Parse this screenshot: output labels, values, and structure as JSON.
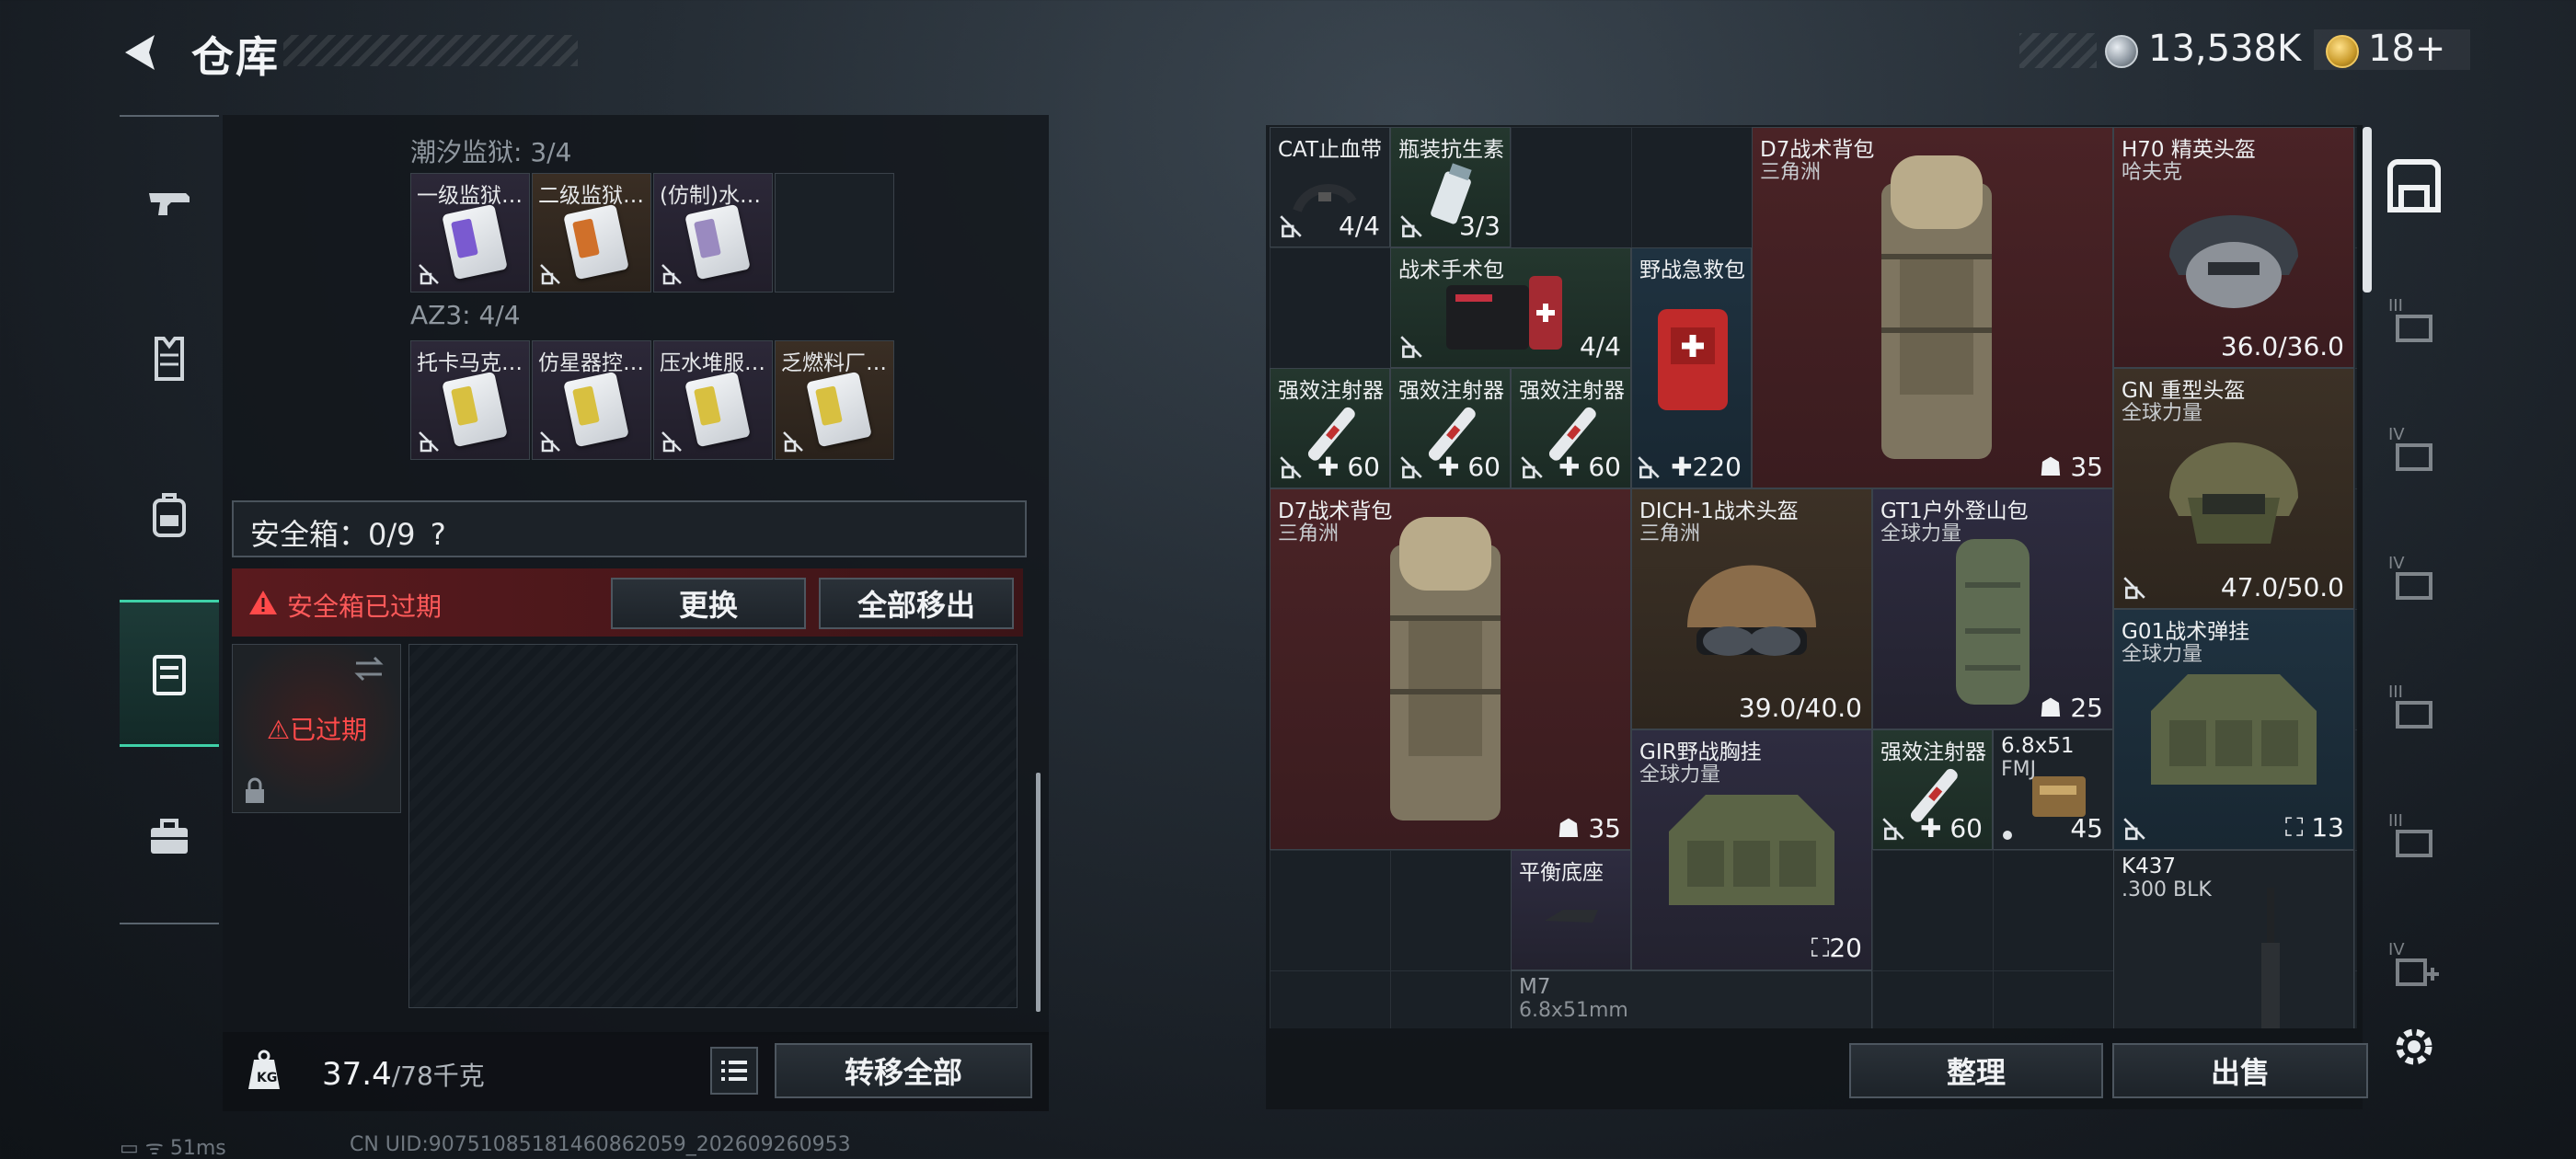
{
  "header": {
    "title": "仓库",
    "coins": "13,538K",
    "tickets": "18+"
  },
  "left_nav": {
    "items": [
      "weapon",
      "armor",
      "backpack",
      "safe-box",
      "briefcase"
    ],
    "selected": "safe-box"
  },
  "sections": {
    "prison": {
      "label": "潮汐监狱: 3/4",
      "slots": [
        "一级监狱…",
        "二级监狱…",
        "(仿制)水…"
      ]
    },
    "az3": {
      "label": "AZ3: 4/4",
      "slots": [
        "托卡马克…",
        "仿星器控…",
        "压水堆服…",
        "乏燃料厂…"
      ]
    }
  },
  "safebox": {
    "label": "安全箱：0/9",
    "help": "?",
    "warning": "安全箱已过期",
    "replace_btn": "更换",
    "move_all_btn": "全部移出",
    "expired": "已过期"
  },
  "bottom": {
    "weight": "37.4",
    "weight_max": "/78千克",
    "transfer_btn": "转移全部"
  },
  "status": {
    "ping": "51ms",
    "uid": "CN UID:9075108518146086205​9_202609260953"
  },
  "items": {
    "cat": {
      "name": "CAT止血带",
      "qty": "4/4"
    },
    "abx": {
      "name": "瓶装抗生素",
      "qty": "3/3"
    },
    "d7a": {
      "name": "D7战术背包",
      "sub": "三角洲",
      "qty": "35"
    },
    "h70": {
      "name": "H70 精英头盔",
      "sub": "哈夫克",
      "qty": "36.0/36.0"
    },
    "surg": {
      "name": "战术手术包",
      "qty": "4/4"
    },
    "field": {
      "name": "野战急救包",
      "qty": "220"
    },
    "inj1": {
      "name": "强效注射器",
      "qty": "60"
    },
    "inj2": {
      "name": "强效注射器",
      "qty": "60"
    },
    "inj3": {
      "name": "强效注射器",
      "qty": "60"
    },
    "gn": {
      "name": "GN 重型头盔",
      "sub": "全球力量",
      "qty": "47.0/50.0"
    },
    "d7b": {
      "name": "D7战术背包",
      "sub": "三角洲",
      "qty": "35"
    },
    "dich": {
      "name": "DICH-1战术头盔",
      "sub": "三角洲",
      "qty": "39.0/40.0"
    },
    "gt1": {
      "name": "GT1户外登山包",
      "sub": "全球力量",
      "qty": "25"
    },
    "g01": {
      "name": "G01战术弹挂",
      "sub": "全球力量",
      "qty": "13"
    },
    "gir": {
      "name": "GIR野战胸挂",
      "sub": "全球力量",
      "qty": "20"
    },
    "inj4": {
      "name": "强效注射器",
      "qty": "60"
    },
    "ammo": {
      "name": "6.8x51",
      "sub": "FMJ",
      "qty": "45"
    },
    "base": {
      "name": "平衡底座"
    },
    "k437": {
      "name": "K437",
      "sub": ".300 BLK"
    },
    "m7": {
      "name": "M7",
      "sub": "6.8x51mm"
    }
  },
  "right_buttons": {
    "sort": "整理",
    "sell": "出售"
  },
  "colors": {
    "accent": "#3fd1a8",
    "warn": "#ff5a5a",
    "green": "#24372e",
    "red": "#4a2326",
    "brown": "#3c3126",
    "purple": "#2e2c40",
    "blue": "#1f3240"
  }
}
